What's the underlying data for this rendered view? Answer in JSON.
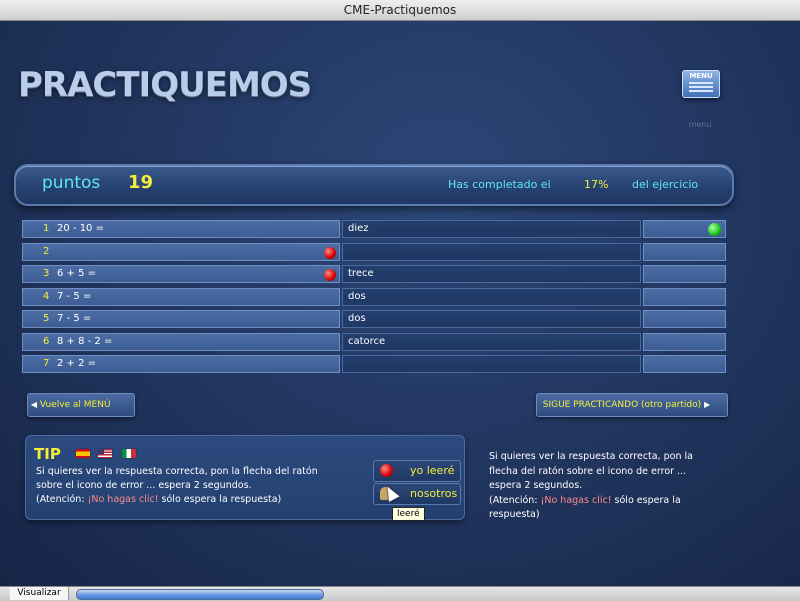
{
  "window": {
    "title": "CME-Practiquemos"
  },
  "header": {
    "logo_text": "PRACTIQUEMOS",
    "menu_icon_text": "MENU",
    "menu_label": "menu"
  },
  "score": {
    "label": "puntos",
    "value": "19",
    "progress_prefix": "Has completado el",
    "progress_percent": "17%",
    "progress_suffix": "del ejercicio"
  },
  "exercises": [
    {
      "num": "1",
      "expr": "20 - 10 =",
      "answer": "diez",
      "error_marker": false,
      "correct_marker": true
    },
    {
      "num": "2",
      "expr": "",
      "answer": "",
      "error_marker": true,
      "correct_marker": false
    },
    {
      "num": "3",
      "expr": "6 + 5 =",
      "answer": "trece",
      "error_marker": true,
      "correct_marker": false
    },
    {
      "num": "4",
      "expr": "7 - 5 =",
      "answer": "dos",
      "error_marker": false,
      "correct_marker": false
    },
    {
      "num": "5",
      "expr": "7 - 5 =",
      "answer": "dos",
      "error_marker": false,
      "correct_marker": false
    },
    {
      "num": "6",
      "expr": "8 + 8 - 2 =",
      "answer": "catorce",
      "error_marker": false,
      "correct_marker": false
    },
    {
      "num": "7",
      "expr": "2 + 2 =",
      "answer": "",
      "error_marker": false,
      "correct_marker": false
    }
  ],
  "nav": {
    "back_label": "Vuelve al MENÚ",
    "next_label": "SIGUE PRACTICANDO (otro partido)"
  },
  "tip": {
    "title": "TIP",
    "text_line1": "Si quieres ver la respuesta correcta, pon la flecha del ratón",
    "text_line2": "sobre el icono de error ... espera 2 segundos.",
    "text_attention": "(Atención:",
    "text_highlight": "¡No hagas clic!",
    "text_end": "sólo espera la respuesta)",
    "button_read_label": "yo leeré",
    "button_us_label": "nosotros",
    "tooltip": "leeré"
  },
  "side_help": {
    "line1": "Si quieres ver la respuesta correcta, pon la",
    "line2": "flecha del ratón sobre el icono de error ...",
    "line3": "espera 2 segundos.",
    "line4_start": "(Atención:",
    "line4_highlight": "¡No hagas clic!",
    "line4_end": "sólo espera la",
    "line5": "respuesta)"
  },
  "statusbar": {
    "button_label": "Visualizar",
    "progress_fraction": 1.0
  },
  "colors": {
    "background": "#20345c",
    "accent_yellow": "#f3ee3c",
    "accent_cyan": "#5ee8ef",
    "error_red": "#d40000",
    "correct_green": "#18c418",
    "highlight_red": "#ff8b8b"
  }
}
